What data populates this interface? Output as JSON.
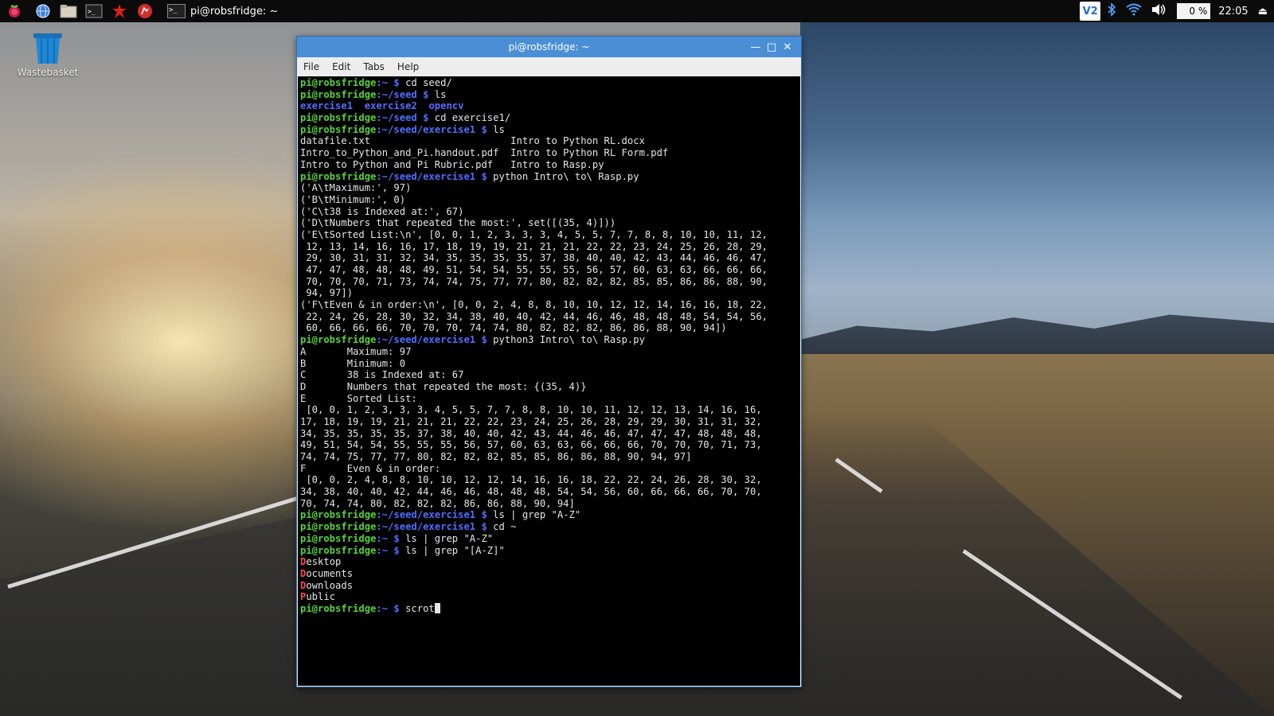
{
  "taskbar": {
    "icons": [
      "raspberry-menu-icon",
      "web-browser-icon",
      "file-manager-icon",
      "terminal-icon",
      "math-kernel-icon",
      "wolfram-icon"
    ],
    "task_label": "pi@robsfridge: ~",
    "tray": {
      "vnc_label": "V2",
      "cpu": "0 %",
      "clock": "22:05"
    }
  },
  "desktop": {
    "wastebasket_label": "Wastebasket"
  },
  "window": {
    "title": "pi@robsfridge: ~",
    "menus": [
      "File",
      "Edit",
      "Tabs",
      "Help"
    ]
  },
  "terminal": {
    "lines": [
      [
        [
          "u",
          "pi@robsfridge"
        ],
        [
          "p",
          ":~ $ "
        ],
        [
          "t",
          "cd seed/"
        ]
      ],
      [
        [
          "u",
          "pi@robsfridge"
        ],
        [
          "p",
          ":~/seed $ "
        ],
        [
          "t",
          "ls"
        ]
      ],
      [
        [
          "d",
          "exercise1"
        ],
        [
          "t",
          "  "
        ],
        [
          "d",
          "exercise2"
        ],
        [
          "t",
          "  "
        ],
        [
          "d",
          "opencv"
        ]
      ],
      [
        [
          "u",
          "pi@robsfridge"
        ],
        [
          "p",
          ":~/seed $ "
        ],
        [
          "t",
          "cd exercise1/"
        ]
      ],
      [
        [
          "u",
          "pi@robsfridge"
        ],
        [
          "p",
          ":~/seed/exercise1 $ "
        ],
        [
          "t",
          "ls"
        ]
      ],
      [
        [
          "t",
          "datafile.txt                        Intro to Python RL.docx"
        ]
      ],
      [
        [
          "t",
          "Intro_to_Python_and_Pi.handout.pdf  Intro to Python RL Form.pdf"
        ]
      ],
      [
        [
          "t",
          "Intro to Python and Pi Rubric.pdf   Intro to Rasp.py"
        ]
      ],
      [
        [
          "u",
          "pi@robsfridge"
        ],
        [
          "p",
          ":~/seed/exercise1 $ "
        ],
        [
          "t",
          "python Intro\\ to\\ Rasp.py"
        ]
      ],
      [
        [
          "t",
          "('A\\tMaximum:', 97)"
        ]
      ],
      [
        [
          "t",
          "('B\\tMinimum:', 0)"
        ]
      ],
      [
        [
          "t",
          "('C\\t38 is Indexed at:', 67)"
        ]
      ],
      [
        [
          "t",
          "('D\\tNumbers that repeated the most:', set([(35, 4)]))"
        ]
      ],
      [
        [
          "t",
          "('E\\tSorted List:\\n', [0, 0, 1, 2, 3, 3, 3, 4, 5, 5, 7, 7, 8, 8, 10, 10, 11, 12,"
        ]
      ],
      [
        [
          "t",
          " 12, 13, 14, 16, 16, 17, 18, 19, 19, 21, 21, 21, 22, 22, 23, 24, 25, 26, 28, 29,"
        ]
      ],
      [
        [
          "t",
          " 29, 30, 31, 31, 32, 34, 35, 35, 35, 35, 37, 38, 40, 40, 42, 43, 44, 46, 46, 47,"
        ]
      ],
      [
        [
          "t",
          " 47, 47, 48, 48, 48, 49, 51, 54, 54, 55, 55, 55, 56, 57, 60, 63, 63, 66, 66, 66,"
        ]
      ],
      [
        [
          "t",
          " 70, 70, 70, 71, 73, 74, 74, 75, 77, 77, 80, 82, 82, 82, 85, 85, 86, 86, 88, 90,"
        ]
      ],
      [
        [
          "t",
          " 94, 97])"
        ]
      ],
      [
        [
          "t",
          "('F\\tEven & in order:\\n', [0, 0, 2, 4, 8, 8, 10, 10, 12, 12, 14, 16, 16, 18, 22,"
        ]
      ],
      [
        [
          "t",
          " 22, 24, 26, 28, 30, 32, 34, 38, 40, 40, 42, 44, 46, 46, 48, 48, 48, 54, 54, 56,"
        ]
      ],
      [
        [
          "t",
          " 60, 66, 66, 66, 70, 70, 70, 74, 74, 80, 82, 82, 82, 86, 86, 88, 90, 94])"
        ]
      ],
      [
        [
          "u",
          "pi@robsfridge"
        ],
        [
          "p",
          ":~/seed/exercise1 $ "
        ],
        [
          "t",
          "python3 Intro\\ to\\ Rasp.py"
        ]
      ],
      [
        [
          "t",
          "A       Maximum: 97"
        ]
      ],
      [
        [
          "t",
          "B       Minimum: 0"
        ]
      ],
      [
        [
          "t",
          "C       38 is Indexed at: 67"
        ]
      ],
      [
        [
          "t",
          "D       Numbers that repeated the most: {(35, 4)}"
        ]
      ],
      [
        [
          "t",
          "E       Sorted List:"
        ]
      ],
      [
        [
          "t",
          " [0, 0, 1, 2, 3, 3, 3, 4, 5, 5, 7, 7, 8, 8, 10, 10, 11, 12, 12, 13, 14, 16, 16,"
        ]
      ],
      [
        [
          "t",
          "17, 18, 19, 19, 21, 21, 21, 22, 22, 23, 24, 25, 26, 28, 29, 29, 30, 31, 31, 32,"
        ]
      ],
      [
        [
          "t",
          "34, 35, 35, 35, 35, 37, 38, 40, 40, 42, 43, 44, 46, 46, 47, 47, 47, 48, 48, 48,"
        ]
      ],
      [
        [
          "t",
          "49, 51, 54, 54, 55, 55, 55, 56, 57, 60, 63, 63, 66, 66, 66, 70, 70, 70, 71, 73,"
        ]
      ],
      [
        [
          "t",
          "74, 74, 75, 77, 77, 80, 82, 82, 82, 85, 85, 86, 86, 88, 90, 94, 97]"
        ]
      ],
      [
        [
          "t",
          "F       Even & in order:"
        ]
      ],
      [
        [
          "t",
          " [0, 0, 2, 4, 8, 8, 10, 10, 12, 12, 14, 16, 16, 18, 22, 22, 24, 26, 28, 30, 32,"
        ]
      ],
      [
        [
          "t",
          "34, 38, 40, 40, 42, 44, 46, 46, 48, 48, 48, 54, 54, 56, 60, 66, 66, 66, 70, 70,"
        ]
      ],
      [
        [
          "t",
          "70, 74, 74, 80, 82, 82, 82, 86, 86, 88, 90, 94]"
        ]
      ],
      [
        [
          "u",
          "pi@robsfridge"
        ],
        [
          "p",
          ":~/seed/exercise1 $ "
        ],
        [
          "t",
          "ls | grep \"A-Z\""
        ]
      ],
      [
        [
          "u",
          "pi@robsfridge"
        ],
        [
          "p",
          ":~/seed/exercise1 $ "
        ],
        [
          "t",
          "cd ~"
        ]
      ],
      [
        [
          "u",
          "pi@robsfridge"
        ],
        [
          "p",
          ":~ $ "
        ],
        [
          "t",
          "ls | grep \"A-Z\""
        ]
      ],
      [
        [
          "u",
          "pi@robsfridge"
        ],
        [
          "p",
          ":~ $ "
        ],
        [
          "t",
          "ls | grep \"[A-Z]\""
        ]
      ],
      [
        [
          "r",
          "D"
        ],
        [
          "t",
          "esktop"
        ]
      ],
      [
        [
          "r",
          "D"
        ],
        [
          "t",
          "ocuments"
        ]
      ],
      [
        [
          "r",
          "D"
        ],
        [
          "t",
          "ownloads"
        ]
      ],
      [
        [
          "r",
          "P"
        ],
        [
          "t",
          "ublic"
        ]
      ],
      [
        [
          "u",
          "pi@robsfridge"
        ],
        [
          "p",
          ":~ $ "
        ],
        [
          "t",
          "scrot"
        ]
      ]
    ]
  }
}
